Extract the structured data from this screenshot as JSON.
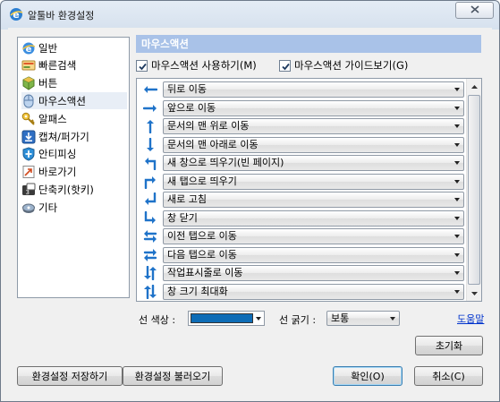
{
  "window": {
    "title": "알툴바 환경설정"
  },
  "sidebar": {
    "items": [
      {
        "label": "일반",
        "icon": "ie-globe-icon"
      },
      {
        "label": "빠른검색",
        "icon": "quick-search-icon"
      },
      {
        "label": "버튼",
        "icon": "button-cube-icon"
      },
      {
        "label": "마우스액션",
        "icon": "mouse-icon",
        "selected": true
      },
      {
        "label": "알패스",
        "icon": "key-icon"
      },
      {
        "label": "캡쳐/퍼가기",
        "icon": "capture-icon"
      },
      {
        "label": "안티피싱",
        "icon": "shield-icon"
      },
      {
        "label": "바로가기",
        "icon": "shortcut-icon"
      },
      {
        "label": "단축키(핫키)",
        "icon": "hotkey-icon"
      },
      {
        "label": "기타",
        "icon": "misc-icon"
      }
    ]
  },
  "section": {
    "title": "마우스액션",
    "enable_label": "마우스액션 사용하기(M)",
    "guide_label": "마우스액션 가이드보기(G)"
  },
  "gestures": [
    {
      "action": "뒤로 이동",
      "gesture": "left"
    },
    {
      "action": "앞으로 이동",
      "gesture": "right"
    },
    {
      "action": "문서의 맨 위로 이동",
      "gesture": "up"
    },
    {
      "action": "문서의 맨 아래로 이동",
      "gesture": "down"
    },
    {
      "action": "새 창으로 띄우기(빈 페이지)",
      "gesture": "up-left"
    },
    {
      "action": "새 탭으로 띄우기",
      "gesture": "up-right"
    },
    {
      "action": "새로 고침",
      "gesture": "down-left"
    },
    {
      "action": "창 닫기",
      "gesture": "down-right"
    },
    {
      "action": "이전 탭으로 이동",
      "gesture": "left-right"
    },
    {
      "action": "다음 탭으로 이동",
      "gesture": "right-left"
    },
    {
      "action": "작업표시줄로 이동",
      "gesture": "down-up"
    },
    {
      "action": "창 크기 최대화",
      "gesture": "up-down"
    }
  ],
  "line_color": {
    "label": "선 색상 :",
    "value": "#0d6cb6"
  },
  "line_width": {
    "label": "선 굵기 :",
    "value": "보통"
  },
  "help_link": "도움말",
  "buttons": {
    "reset": "초기화",
    "save_settings": "환경설정 저장하기",
    "load_settings": "환경설정 불러오기",
    "ok": "확인(O)",
    "cancel": "취소(C)"
  },
  "colors": {
    "accent": "#a9c2e8",
    "icon_blue": "#1f73c9"
  }
}
